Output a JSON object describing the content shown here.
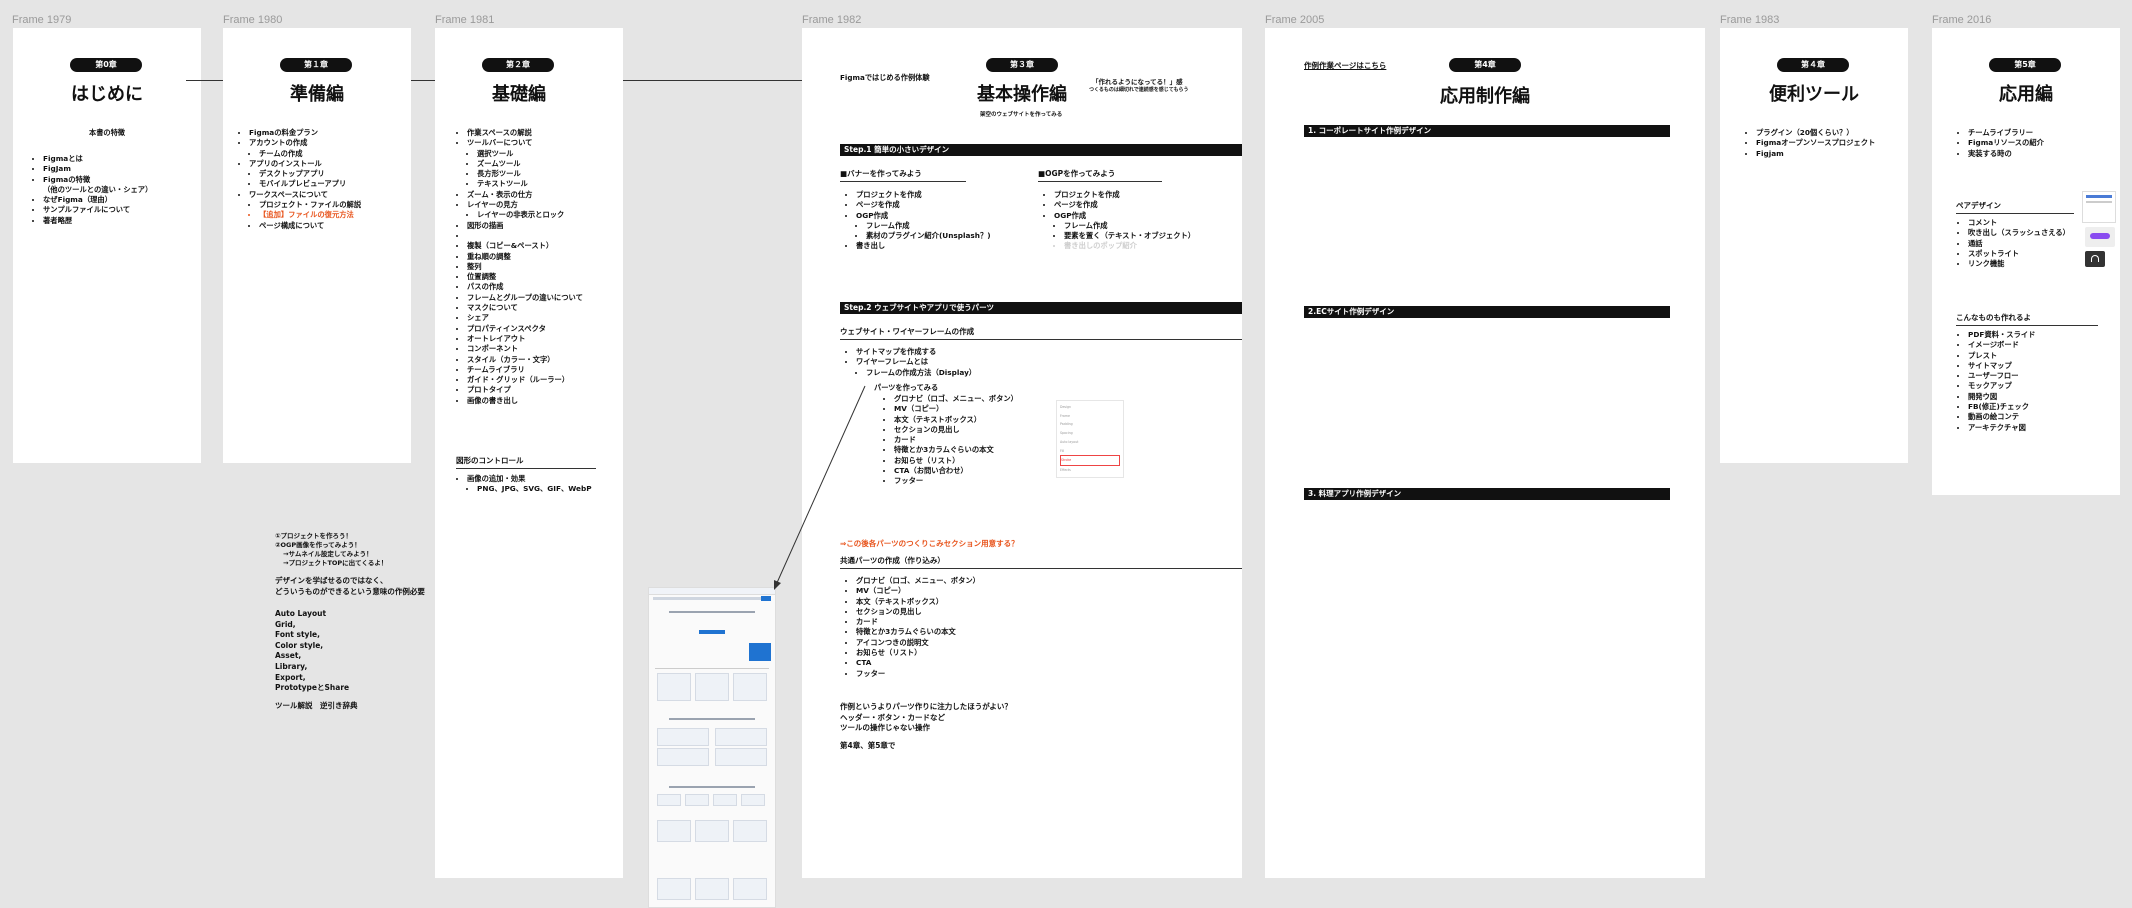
{
  "frames": {
    "f1979": {
      "label": "Frame 1979",
      "chapter": "第0章",
      "title": "はじめに",
      "subtitle": "本書の特徴",
      "items": [
        "Figmaとは",
        "FigJam",
        "Figmaの特徴",
        "（他のツールとの違い・シェア）",
        "なぜFigma（理由）",
        "サンプルファイルについて",
        "著者略歴"
      ]
    },
    "f1980": {
      "label": "Frame 1980",
      "chapter": "第１章",
      "title": "準備編",
      "items": [
        "Figmaの料金プラン",
        "アカウントの作成",
        "チームの作成",
        "アプリのインストール",
        "デスクトップアプリ",
        "モバイルプレビューアプリ",
        "ワークスペースについて",
        "プロジェクト・ファイルの解説",
        "【追加】ファイルの復元方法",
        "ページ構成について"
      ],
      "notes": [
        "①プロジェクトを作ろう！",
        "②OGP画像を作ってみよう！",
        "→サムネイル設定してみよう！",
        "→プロジェクトTOPに出てくるよ！"
      ],
      "note2": [
        "デザインを学ばせるのではなく、",
        "どういうものができるという意味の作例必要"
      ],
      "features": [
        "Auto Layout",
        "Grid,",
        "Font style,",
        "Color style,",
        "Asset,",
        "Library,",
        "Export,",
        "PrototypeとShare"
      ],
      "tools": "ツール解説　逆引き辞典"
    },
    "f1981": {
      "label": "Frame 1981",
      "chapter": "第２章",
      "title": "基礎編",
      "items": [
        "作業スペースの解説",
        "ツールバーについて",
        "選択ツール",
        "ズームツール",
        "長方形ツール",
        "テキストツール",
        "ズーム・表示の仕方",
        "レイヤーの見方",
        "レイヤーの非表示とロック",
        "図形の描画",
        "",
        "複製（コピー&ペースト）",
        "重ね順の調整",
        "整列",
        "位置調整",
        "パスの作成",
        "フレームとグループの違いについて",
        "マスクについて",
        "シェア",
        "プロパティインスペクタ",
        "オートレイアウト",
        "コンポーネント",
        "スタイル（カラー・文字）",
        "チームライブラリ",
        "ガイド・グリッド（ルーラー）",
        "プロトタイプ",
        "画像の書き出し"
      ],
      "section2": "図形のコントロール",
      "items2": [
        "画像の追加・効果",
        "PNG、JPG、SVG、GIF、WebP"
      ]
    },
    "f1982": {
      "label": "Frame 1982",
      "chapter": "第３章",
      "title": "基本操作編",
      "topleft": "Figmaではじめる作例体験",
      "tagline": "「作れるようになってる！」感",
      "tagline2": "つくるものは細切れで連続感を感じてもらう",
      "titlesub": "架空のウェブサイトを作ってみる",
      "step1": "Step.1 簡単の小さいデザイン",
      "banner_head": "■バナーを作ってみよう",
      "banner_items": [
        "プロジェクトを作成",
        "ページを作成",
        "OGP作成",
        "フレーム作成",
        "素材のプラグイン紹介(Unsplash？)",
        "書き出し"
      ],
      "ogp_head": "■OGPを作ってみよう",
      "ogp_items": [
        "プロジェクトを作成",
        "ページを作成",
        "OGP作成",
        "フレーム作成",
        "要素を置く（テキスト・オブジェクト）",
        "書き出しのポップ紹介"
      ],
      "step2": "Step.2 ウェブサイトやアプリで使うパーツ",
      "wire_head": "ウェブサイト・ワイヤーフレームの作成",
      "wire_items": [
        "サイトマップを作成する",
        "ワイヤーフレームとは",
        "フレームの作成方法（Display）"
      ],
      "parts_head": "パーツを作ってみる",
      "parts_items": [
        "グロナビ（ロゴ、メニュー、ボタン）",
        "MV（コピー）",
        "本文（テキストボックス）",
        "セクションの見出し",
        "カード",
        "特徴とか3カラムぐらいの本文",
        "お知らせ（リスト）",
        "CTA（お問い合わせ）",
        "フッター"
      ],
      "orange": "⇒この後各パーツのつくりこみセクション用意する？",
      "common_head": "共通パーツの作成（作り込み）",
      "common_items": [
        "グロナビ（ロゴ、メニュー、ボタン）",
        "MV（コピー）",
        "本文（テキストボックス）",
        "セクションの見出し",
        "カード",
        "特徴とか3カラムぐらいの本文",
        "アイコンつきの説明文",
        "お知らせ（リスト）",
        "CTA",
        "フッター"
      ],
      "note": [
        "作例というよりパーツ作りに注力したほうがよい？",
        "ヘッダー・ボタン・カードなど",
        "ツールの操作じゃない操作"
      ],
      "note2": "第4章、第5章で",
      "panel_rows": [
        "Design",
        "Frame",
        "Padding",
        "Spacing",
        "Auto layout",
        "Fill",
        "Stroke",
        "Effects"
      ]
    },
    "f2005": {
      "label": "Frame 2005",
      "chapter": "第4章",
      "title": "応用制作編",
      "link": "作例作業ページはこちら",
      "bars": [
        "1. コーポレートサイト作例デザイン",
        "2.ECサイト作例デザイン",
        "3. 料理アプリ作例デザイン"
      ]
    },
    "f1983": {
      "label": "Frame 1983",
      "chapter": "第４章",
      "title": "便利ツール",
      "items": [
        "プラグイン（20個くらい？）",
        "Figmaオープンソースプロジェクト",
        "Figjam"
      ]
    },
    "f2016": {
      "label": "Frame 2016",
      "chapter": "第5章",
      "title": "応用編",
      "items": [
        "チームライブラリー",
        "Figmaリソースの紹介",
        "実装する時の"
      ],
      "pair_head": "ペアデザイン",
      "pair_items": [
        "コメント",
        "吹き出し（スラッシュさえる）",
        "通話",
        "スポットライト",
        "リンク機能"
      ],
      "make_head": "こんなものも作れるよ",
      "make_items": [
        "PDF資料・スライド",
        "イメージボード",
        "プレスト",
        "サイトマップ",
        "ユーザーフロー",
        "モックアップ",
        "開発ウ図",
        "FB(修正)チェック",
        "動画の絵コンテ",
        "アーキテクチャ図"
      ]
    }
  },
  "colors": {
    "canvas": "#e5e5e5",
    "frame": "#ffffff",
    "ink": "#111111",
    "accent_red": "#e8541c",
    "label_gray": "#9a9a9a"
  }
}
